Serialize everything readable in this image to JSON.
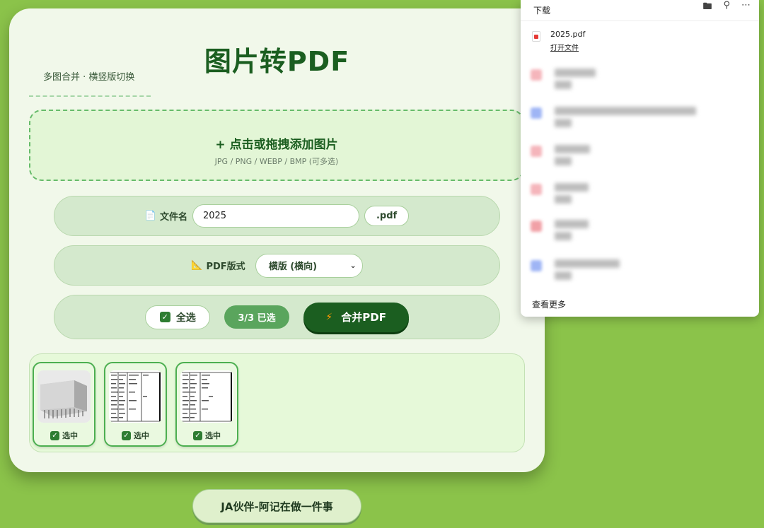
{
  "app": {
    "title": "图片转PDF",
    "subtitle": "多图合并 · 横竖版切换"
  },
  "dropzone": {
    "main": "+ 点击或拖拽添加图片",
    "hint": "JPG / PNG / WEBP / BMP (可多选)"
  },
  "filename": {
    "icon": "document-icon",
    "label": "文件名",
    "value": "2025",
    "ext": ".pdf"
  },
  "format": {
    "icon": "ruler-triangle-icon",
    "label": "PDF版式",
    "selected": "横版 (横向)"
  },
  "actions": {
    "select_all": "全选",
    "selected_count": "3/3 已选",
    "merge": "合并PDF"
  },
  "thumbnails": [
    {
      "label": "选中",
      "checked": true,
      "kind": "photo"
    },
    {
      "label": "选中",
      "checked": true,
      "kind": "document"
    },
    {
      "label": "选中",
      "checked": true,
      "kind": "document"
    }
  ],
  "footer": {
    "label": "JA伙伴-阿记在做一件事"
  },
  "downloads": {
    "title": "下载",
    "items": [
      {
        "name": "2025.pdf",
        "action": "打开文件"
      }
    ],
    "more": "查看更多"
  },
  "colors": {
    "background": "#8bc34a",
    "primary": "#1b5e20",
    "accent": "#5aa55d"
  }
}
